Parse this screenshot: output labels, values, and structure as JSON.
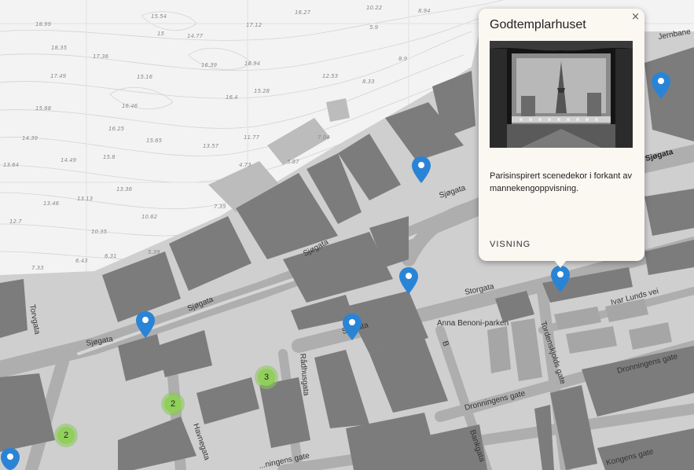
{
  "map": {
    "depth_labels": [
      "18.99",
      "15.54",
      "14.77",
      "15",
      "16.27",
      "17.12",
      "10.22",
      "8.94",
      "18.35",
      "17.36",
      "16.39",
      "16.94",
      "12.53",
      "8.33",
      "8.9",
      "17.49",
      "15.16",
      "15.28",
      "16.4",
      "5.9",
      "15.68",
      "16.46",
      "16.25",
      "15.65",
      "13.57",
      "11.77",
      "7.04",
      "14.39",
      "14.49",
      "15.8",
      "13.64",
      "13.36",
      "13.46",
      "13.13",
      "12.7",
      "10.62",
      "10.35",
      "6.31",
      "6.43",
      "5.39",
      "7.35",
      "5.87",
      "4.73",
      "7.33"
    ],
    "streets": {
      "sjogata_1": "Sjøgata",
      "sjogata_2": "Sjøgata",
      "sjogata_3": "Sjøgata",
      "sjogata_4": "Sjøgata",
      "sjogata_5": "Sjøgata",
      "sjogata_6": "Sjøgata",
      "torvgata": "Torvgata",
      "storgata": "Storgata",
      "anna_benoni": "Anna Benoni-parken",
      "ivar_lunds": "Ivar Lunds vei",
      "tordenskjolds": "Tordenskjolds gate",
      "dronningens_1": "Dronningens gate",
      "dronningens_2": "Dronningens gate",
      "dronningens_3": "...ningens gate",
      "radhusgata": "Rådhusgata",
      "havnegata": "Havnegata",
      "bankgata": "Bankgata",
      "kongens": "Kongens gate",
      "jernbane": "Jernbane",
      "b_label": "B"
    },
    "clusters": [
      {
        "count": "3"
      },
      {
        "count": "2"
      },
      {
        "count": "2"
      }
    ]
  },
  "popup": {
    "title": "Godtemplarhuset",
    "description": "Parisinspirert scenedekor i forkant av mannekengoppvisning.",
    "link": "VISNING",
    "close": "×"
  },
  "colors": {
    "marker": "#2a84d6",
    "cluster": "#8fcf5a",
    "water": "#f2f2f2",
    "land": "#cfcfcf",
    "building": "#7a7a7a",
    "road": "#bdbdbd"
  }
}
